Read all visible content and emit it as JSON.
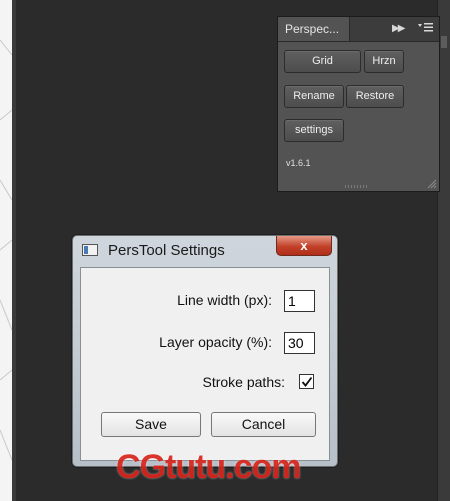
{
  "panel": {
    "tab_label": "Perspec...",
    "buttons": {
      "grid": "Grid",
      "hrzn": "Hrzn",
      "rename": "Rename",
      "restore": "Restore",
      "settings": "settings"
    },
    "version": "v1.6.1",
    "icons": [
      "collapse-arrows-icon",
      "panel-menu-icon",
      "resize-grip-icon"
    ]
  },
  "dialog": {
    "title": "PersTool Settings",
    "close_label": "x",
    "fields": {
      "line_width": {
        "label": "Line width (px):",
        "value": "1"
      },
      "layer_opacity": {
        "label": "Layer opacity (%):",
        "value": "30"
      }
    },
    "stroke_paths": {
      "label": "Stroke paths:",
      "checked": true
    },
    "save_label": "Save",
    "cancel_label": "Cancel"
  },
  "watermark": {
    "text": "CGtutu.com",
    "color": "#d9261c"
  },
  "colors": {
    "workspace": "#2b2b2b",
    "panel": "#535353",
    "dialog_frame": "#b7c0c9",
    "close_button": "#c2412b"
  }
}
